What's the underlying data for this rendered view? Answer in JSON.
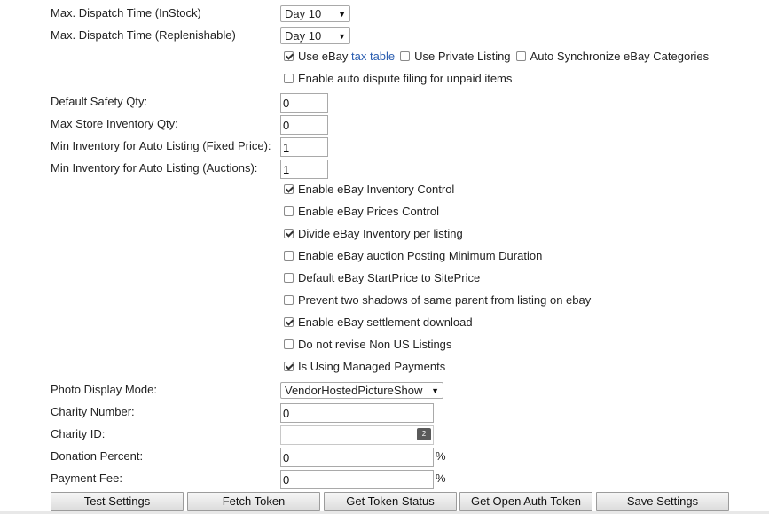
{
  "fields": {
    "dispatch_instock": {
      "label": "Max. Dispatch Time (InStock)",
      "value": "Day 10"
    },
    "dispatch_replenishable": {
      "label": "Max. Dispatch Time (Replenishable)",
      "value": "Day 10"
    },
    "default_safety_qty": {
      "label": "Default Safety Qty:",
      "value": "0"
    },
    "max_store_inventory": {
      "label": "Max Store Inventory Qty:",
      "value": "0"
    },
    "min_inv_fixed": {
      "label": "Min Inventory for Auto Listing (Fixed Price):",
      "value": "1"
    },
    "min_inv_auctions": {
      "label": "Min Inventory for Auto Listing (Auctions):",
      "value": "1"
    },
    "photo_display_mode": {
      "label": "Photo Display Mode:",
      "value": "VendorHostedPictureShow"
    },
    "charity_number": {
      "label": "Charity Number:",
      "value": "0"
    },
    "charity_id": {
      "label": "Charity ID:",
      "value": ""
    },
    "donation_percent": {
      "label": "Donation Percent:",
      "value": "0",
      "unit": "%"
    },
    "payment_fee": {
      "label": "Payment Fee:",
      "value": "0",
      "unit": "%"
    }
  },
  "options_row1": {
    "use_ebay": {
      "label": "Use eBay",
      "link": "tax table",
      "checked": true
    },
    "private_listing": {
      "label": "Use Private Listing",
      "checked": false
    },
    "auto_sync": {
      "label": "Auto Synchronize eBay Categories",
      "checked": false
    }
  },
  "auto_dispute": {
    "label": "Enable auto dispute filing for unpaid items",
    "checked": false
  },
  "checkboxes": [
    {
      "label": "Enable eBay Inventory Control",
      "checked": true
    },
    {
      "label": "Enable eBay Prices Control",
      "checked": false
    },
    {
      "label": "Divide eBay Inventory per listing",
      "checked": true
    },
    {
      "label": "Enable eBay auction Posting Minimum Duration",
      "checked": false
    },
    {
      "label": "Default eBay StartPrice to SitePrice",
      "checked": false
    },
    {
      "label": "Prevent two shadows of same parent from listing on ebay",
      "checked": false
    },
    {
      "label": "Enable eBay settlement download",
      "checked": true
    },
    {
      "label": "Do not revise Non US Listings",
      "checked": false
    },
    {
      "label": "Is Using Managed Payments",
      "checked": true
    }
  ],
  "icons": {
    "keyboard_badge": "2"
  },
  "buttons": {
    "test_settings": "Test Settings",
    "fetch_token": "Fetch Token",
    "get_token_status": "Get Token Status",
    "get_open_auth_token": "Get Open Auth Token",
    "save_settings": "Save Settings"
  }
}
